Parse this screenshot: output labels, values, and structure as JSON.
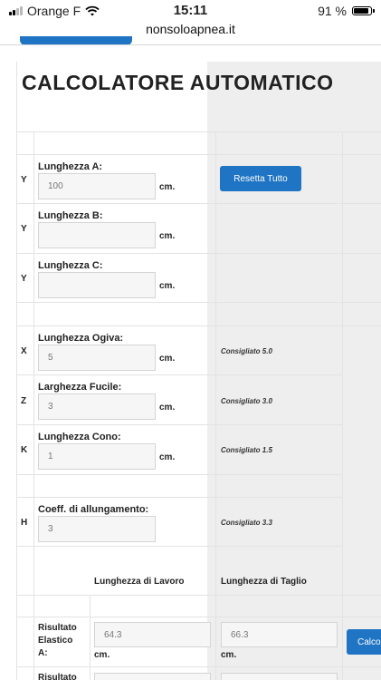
{
  "status_bar": {
    "carrier": "Orange F",
    "time": "15:11",
    "battery": "91 %",
    "battery_level": 0.91
  },
  "browser": {
    "url": "nonsoloapnea.it"
  },
  "page": {
    "title": "CALCOLATORE AUTOMATICO",
    "reset_button": "Resetta Tutto",
    "calc_button": "Calcola",
    "unit": "cm.",
    "rows": {
      "a": {
        "code": "Y",
        "label": "Lunghezza A:",
        "value": "100"
      },
      "b": {
        "code": "Y",
        "label": "Lunghezza B:",
        "value": ""
      },
      "c": {
        "code": "Y",
        "label": "Lunghezza C:",
        "value": ""
      },
      "ogiva": {
        "code": "X",
        "label": "Lunghezza Ogiva:",
        "value": "5",
        "hint": "Consigliato 5.0"
      },
      "fucile": {
        "code": "Z",
        "label": "Larghezza Fucile:",
        "value": "3",
        "hint": "Consigliato 3.0"
      },
      "cono": {
        "code": "K",
        "label": "Lunghezza Cono:",
        "value": "1",
        "hint": "Consigliato 1.5"
      },
      "coeff": {
        "code": "H",
        "label": "Coeff. di allungamento:",
        "value": "3",
        "hint": "Consigliato 3.3"
      }
    },
    "results": {
      "col_lavoro": "Lunghezza di Lavoro",
      "col_taglio": "Lunghezza di Taglio",
      "a": {
        "label_1": "Risultato",
        "label_2": "Elastico",
        "label_3": "A:",
        "lavoro": "64.3",
        "taglio": "66.3"
      },
      "b": {
        "label_1": "Risultato"
      }
    }
  }
}
